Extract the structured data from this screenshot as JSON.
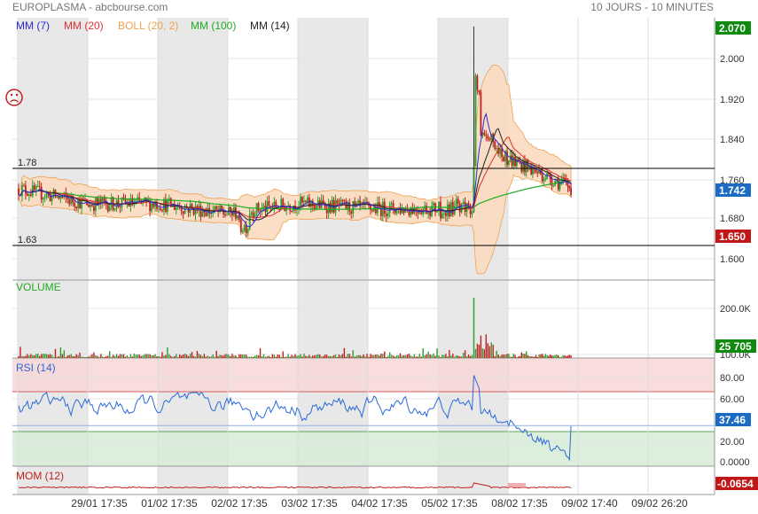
{
  "header": {
    "title": "EUROPLASMA - abcbourse.com",
    "period": "10 JOURS - 10 MINUTES"
  },
  "legend": [
    {
      "label": "MM (7)",
      "color": "#2a2ad8"
    },
    {
      "label": "MM (20)",
      "color": "#e03030"
    },
    {
      "label": "BOLL (20, 2)",
      "color": "#f0a050"
    },
    {
      "label": "MM (100)",
      "color": "#22aa22"
    },
    {
      "label": "MM (14)",
      "color": "#222222"
    }
  ],
  "ref_lines": [
    {
      "label": "1.78",
      "value": 1.78
    },
    {
      "label": "1.63",
      "value": 1.63
    }
  ],
  "badges": {
    "high": "2.070",
    "last": "1.742",
    "low": "1.650",
    "volume": "25 705",
    "rsi": "37.46",
    "mom": "-0.0654"
  },
  "panels": {
    "volume": "VOLUME",
    "rsi": "RSI (14)",
    "mom": "MOM (12)"
  },
  "colors": {
    "up": "#2e9e2e",
    "down": "#c02020",
    "boll_fill": "#f9dcc0",
    "shade": "#e8e8e8",
    "overbought": "#f8d6d6",
    "oversold": "#d6ecd6",
    "badge_high": "#0e8a0e",
    "badge_last": "#1b6bc4",
    "badge_low": "#c01818",
    "badge_mom": "#c01818",
    "rsi_line": "#2a6ad8",
    "mom_line": "#c02020"
  },
  "chart_data": [
    {
      "type": "candlestick",
      "title": "EUROPLASMA",
      "x_ticks": [
        "29/01 17:35",
        "01/02 17:35",
        "02/02 17:35",
        "03/02 17:35",
        "04/02 17:35",
        "05/02 17:35",
        "08/02 17:35",
        "09/02 17:40",
        "09/02 26:20"
      ],
      "y_ticks": [
        "2.000",
        "1.920",
        "1.840",
        "1.760",
        "1.680",
        "1.600"
      ],
      "ylim": [
        1.565,
        2.08
      ],
      "annotations": [
        "1.78",
        "1.63"
      ],
      "series_summary": [
        {
          "day": "29/01",
          "open": 1.74,
          "close": 1.71,
          "high": 1.77,
          "low": 1.69
        },
        {
          "day": "01/02",
          "open": 1.71,
          "close": 1.71,
          "high": 1.75,
          "low": 1.69
        },
        {
          "day": "02/02",
          "open": 1.71,
          "close": 1.69,
          "high": 1.74,
          "low": 1.68
        },
        {
          "day": "03/02",
          "open": 1.69,
          "close": 1.71,
          "high": 1.72,
          "low": 1.65
        },
        {
          "day": "04/02",
          "open": 1.71,
          "close": 1.7,
          "high": 1.73,
          "low": 1.68
        },
        {
          "day": "05/02",
          "open": 1.7,
          "close": 1.7,
          "high": 1.75,
          "low": 1.67
        },
        {
          "day": "08/02",
          "open": 1.7,
          "close": 1.8,
          "high": 2.07,
          "low": 1.68
        },
        {
          "day": "09/02",
          "open": 1.8,
          "close": 1.742,
          "high": 1.85,
          "low": 1.74
        }
      ]
    },
    {
      "type": "bar",
      "title": "VOLUME",
      "y_ticks": [
        "200.0K",
        "100.0K"
      ],
      "last": 25705
    },
    {
      "type": "line",
      "title": "RSI (14)",
      "y_ticks": [
        "80.00",
        "60.00",
        "20.00",
        "0.0000"
      ],
      "ylim": [
        0,
        100
      ],
      "overbought": 70,
      "oversold": 30,
      "last": 37.46
    },
    {
      "type": "line",
      "title": "MOM (12)",
      "last": -0.0654
    }
  ]
}
